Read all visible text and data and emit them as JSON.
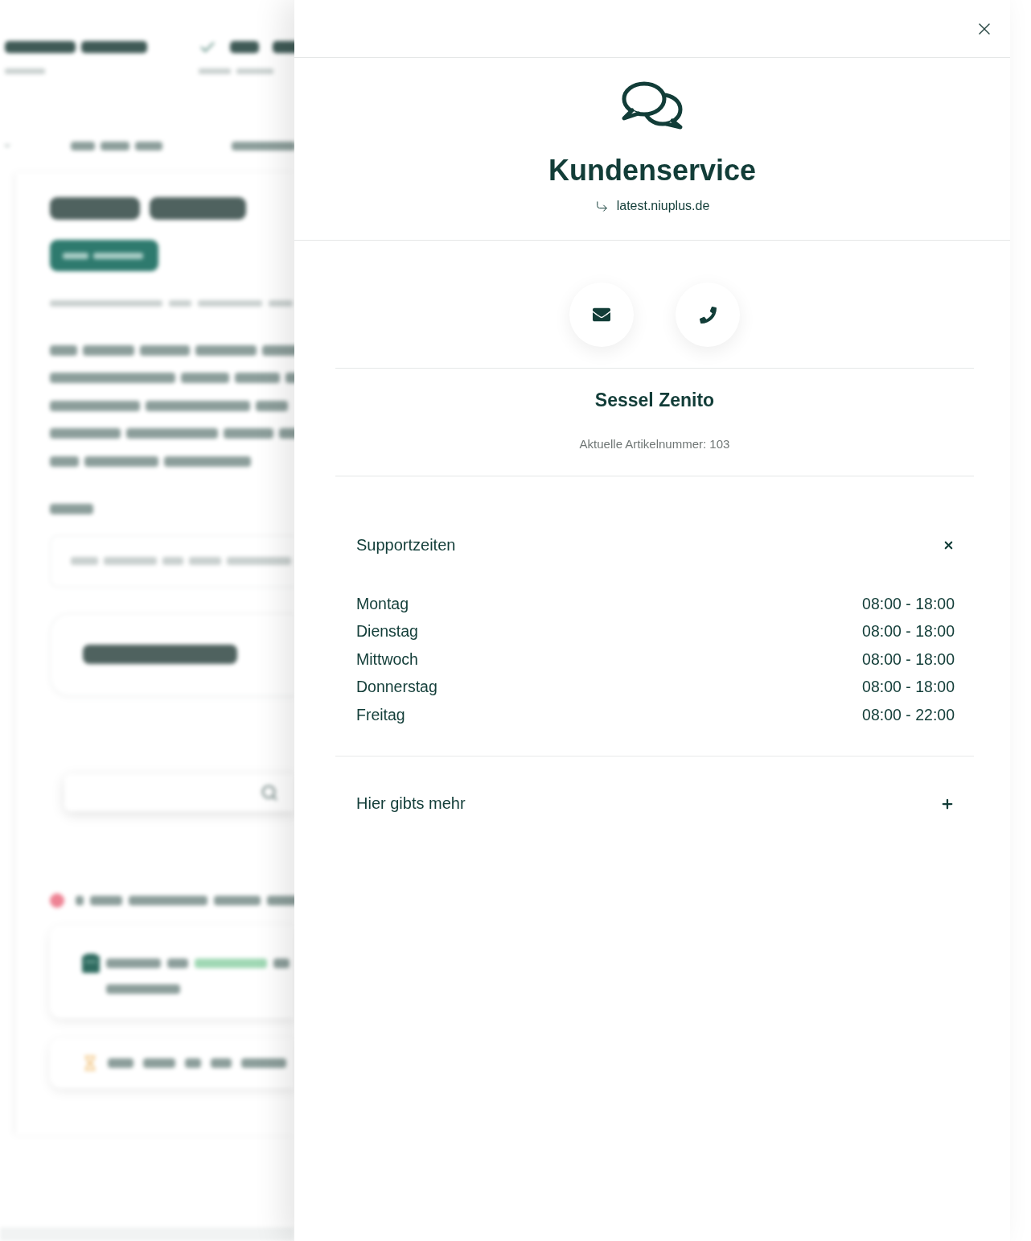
{
  "drawer": {
    "title": "Kundenservice",
    "link": "latest.niuplus.de",
    "contact_buttons": [
      {
        "kind": "email"
      },
      {
        "kind": "phone"
      }
    ],
    "product": {
      "name": "Sessel Zenito",
      "article_number": "Aktuelle Artikelnummer: 103"
    },
    "accordion": [
      {
        "title": "Supportzeiten",
        "expanded": true,
        "hours": [
          {
            "day": "Montag",
            "time": "08:00 - 18:00"
          },
          {
            "day": "Dienstag",
            "time": "08:00 - 18:00"
          },
          {
            "day": "Mittwoch",
            "time": "08:00 - 18:00"
          },
          {
            "day": "Donnerstag",
            "time": "08:00 - 18:00"
          },
          {
            "day": "Freitag",
            "time": "08:00 - 22:00"
          }
        ]
      },
      {
        "title": "Hier gibts mehr",
        "expanded": false
      }
    ]
  }
}
